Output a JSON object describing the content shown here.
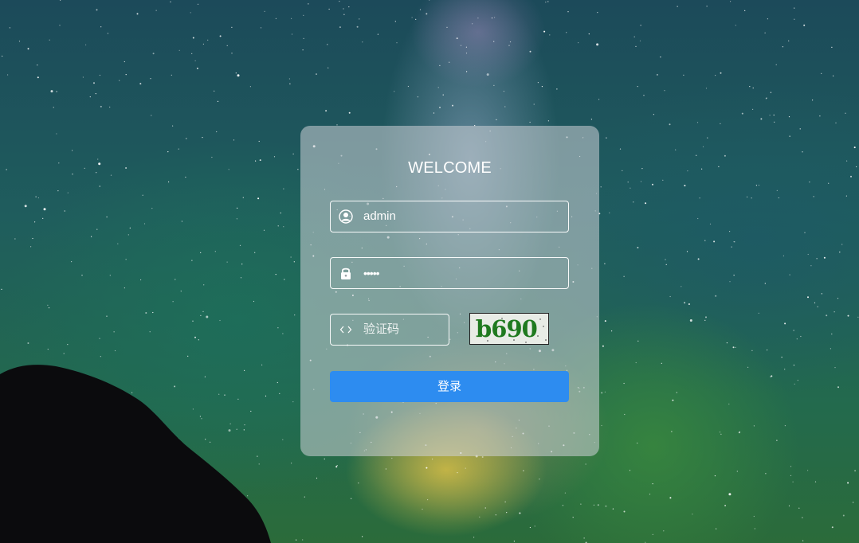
{
  "login": {
    "title": "WELCOME",
    "username_value": "admin",
    "password_mask": "•••••",
    "captcha_placeholder": "验证码",
    "captcha_code": "b690",
    "submit_label": "登录"
  },
  "colors": {
    "button_primary": "#2d8cf0",
    "captcha_text": "#1f7a1f"
  },
  "icons": {
    "username": "user-icon",
    "password": "lock-icon",
    "captcha": "code-icon"
  }
}
